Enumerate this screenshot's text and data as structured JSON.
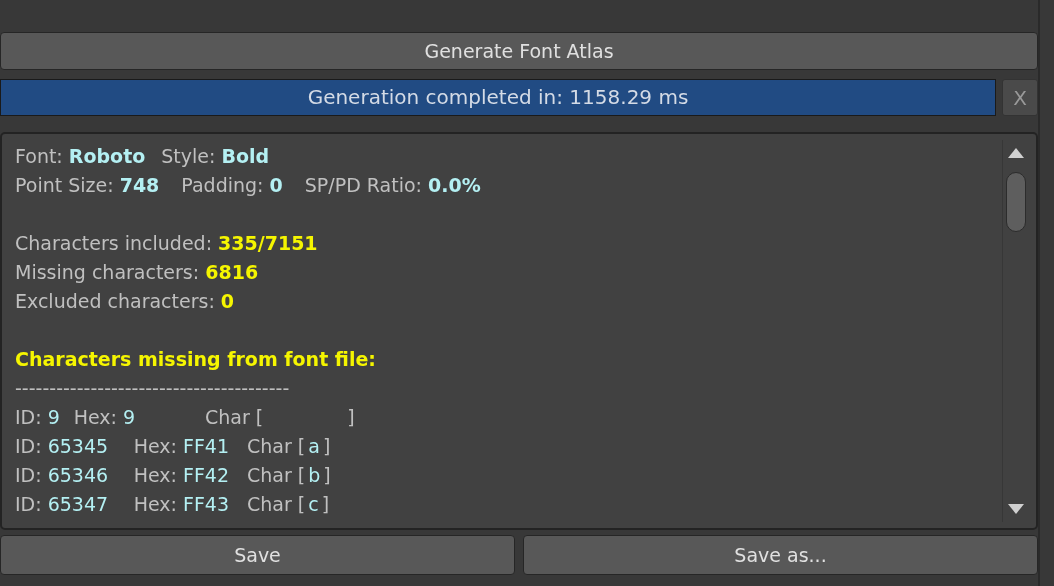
{
  "generate_button": {
    "label": "Generate Font Atlas"
  },
  "progress": {
    "text": "Generation completed in: 1158.29 ms",
    "level": 1.0,
    "close_label": "X"
  },
  "report": {
    "sections": [
      [
        {
          "segments": [
            {
              "text": "Font:",
              "kind": "label"
            },
            {
              "text": "Roboto",
              "kind": "info"
            },
            {
              "text": "Style:",
              "kind": "label"
            },
            {
              "text": "Bold",
              "kind": "info"
            }
          ]
        },
        {
          "segments": [
            {
              "text": "Point Size:",
              "kind": "label"
            },
            {
              "text": "748",
              "kind": "info"
            },
            {
              "text": "Padding:",
              "kind": "label"
            },
            {
              "text": "0",
              "kind": "info"
            },
            {
              "text": "SP/PD Ratio:",
              "kind": "label"
            },
            {
              "text": "0.0%",
              "kind": "info"
            }
          ]
        }
      ],
      [
        {
          "segments": [
            {
              "text": "Characters included:",
              "kind": "label"
            },
            {
              "text": "335/7151",
              "kind": "count"
            }
          ]
        },
        {
          "segments": [
            {
              "text": "Missing characters:",
              "kind": "label"
            },
            {
              "text": "6816",
              "kind": "count"
            }
          ]
        },
        {
          "segments": [
            {
              "text": "Excluded characters:",
              "kind": "label"
            },
            {
              "text": "0",
              "kind": "count"
            }
          ]
        }
      ],
      [
        {
          "segments": [
            {
              "text": "Characters missing from font file:",
              "kind": "heading"
            }
          ]
        },
        {
          "segments": [
            {
              "text": "----------------------------------------",
              "kind": "label"
            }
          ]
        }
      ]
    ],
    "missing_characters": [
      {
        "id_label": "ID:",
        "id": "9",
        "hex_label": "Hex:",
        "hex": "9",
        "char_open": "Char [",
        "char_close": "]"
      },
      {
        "id_label": "ID:",
        "id": "65345",
        "hex_label": "Hex:",
        "hex": "FF41",
        "char_open": "Char [",
        "char": "a",
        "char_close": "]"
      },
      {
        "id_label": "ID:",
        "id": "65346",
        "hex_label": "Hex:",
        "hex": "FF42",
        "char_open": "Char [",
        "char": "b",
        "char_close": "]"
      },
      {
        "id_label": "ID:",
        "id": "65347",
        "hex_label": "Hex:",
        "hex": "FF43",
        "char_open": "Char [",
        "char": "c",
        "char_close": "]"
      }
    ]
  },
  "buttons": [
    {
      "label": "Save"
    },
    {
      "label": "Save as..."
    }
  ]
}
